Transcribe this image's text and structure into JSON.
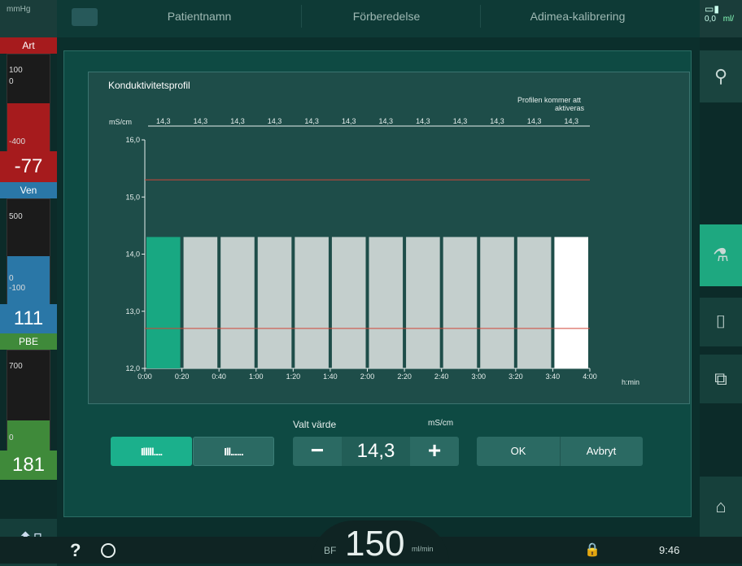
{
  "top": {
    "unit": "mmHg",
    "tabs": [
      "Patientnamn",
      "Förberedelse",
      "Adimea-kalibrering"
    ],
    "right_value": "0,0",
    "right_unit": "ml/"
  },
  "left": {
    "art": {
      "label": "Art",
      "top": "100",
      "zero": "0",
      "bottom": "-400",
      "value": "-77",
      "color": "#a61b1d"
    },
    "ven": {
      "label": "Ven",
      "top": "500",
      "zero": "0",
      "bottom": "-100",
      "value": "111",
      "color": "#2a77a7"
    },
    "pbe": {
      "label": "PBE",
      "top": "700",
      "zero": "0",
      "value": "181",
      "color": "#3f8a3a"
    }
  },
  "dialog": {
    "title": "Konduktivitetsprofil",
    "note_line1": "Profilen kommer att",
    "note_line2": "aktiveras",
    "unit": "mS/cm",
    "time_unit": "h:min",
    "selected_label": "Valt värde",
    "selected_unit": "mS/cm",
    "selected_value": "14,3",
    "ok": "OK",
    "cancel": "Avbryt",
    "minus": "−",
    "plus": "+"
  },
  "chart_data": {
    "type": "bar",
    "categories": [
      "0:00-0:20",
      "0:20-0:40",
      "0:40-1:00",
      "1:00-1:20",
      "1:20-1:40",
      "1:40-2:00",
      "2:00-2:20",
      "2:20-2:40",
      "2:40-3:00",
      "3:00-3:20",
      "3:20-3:40",
      "3:40-4:00"
    ],
    "values": [
      14.3,
      14.3,
      14.3,
      14.3,
      14.3,
      14.3,
      14.3,
      14.3,
      14.3,
      14.3,
      14.3,
      14.3
    ],
    "top_labels": [
      "14,3",
      "14,3",
      "14,3",
      "14,3",
      "14,3",
      "14,3",
      "14,3",
      "14,3",
      "14,3",
      "14,3",
      "14,3",
      "14,3"
    ],
    "x_ticks": [
      "0:00",
      "0:20",
      "0:40",
      "1:00",
      "1:20",
      "1:40",
      "2:00",
      "2:20",
      "2:40",
      "3:00",
      "3:20",
      "3:40",
      "4:00"
    ],
    "y_ticks": [
      "16,0",
      "15,0",
      "14,0",
      "13,0",
      "12,0"
    ],
    "ylim": [
      12.0,
      16.0
    ],
    "limits": [
      15.3,
      12.7
    ],
    "colors": {
      "active": "#18a882",
      "normal": "#c4cfcd",
      "last": "#ffffff",
      "limit": "#d0463a"
    }
  },
  "bottom": {
    "help": "?",
    "bf_label": "BF",
    "bf_value": "150",
    "bf_unit": "ml/min",
    "time": "9:46"
  }
}
